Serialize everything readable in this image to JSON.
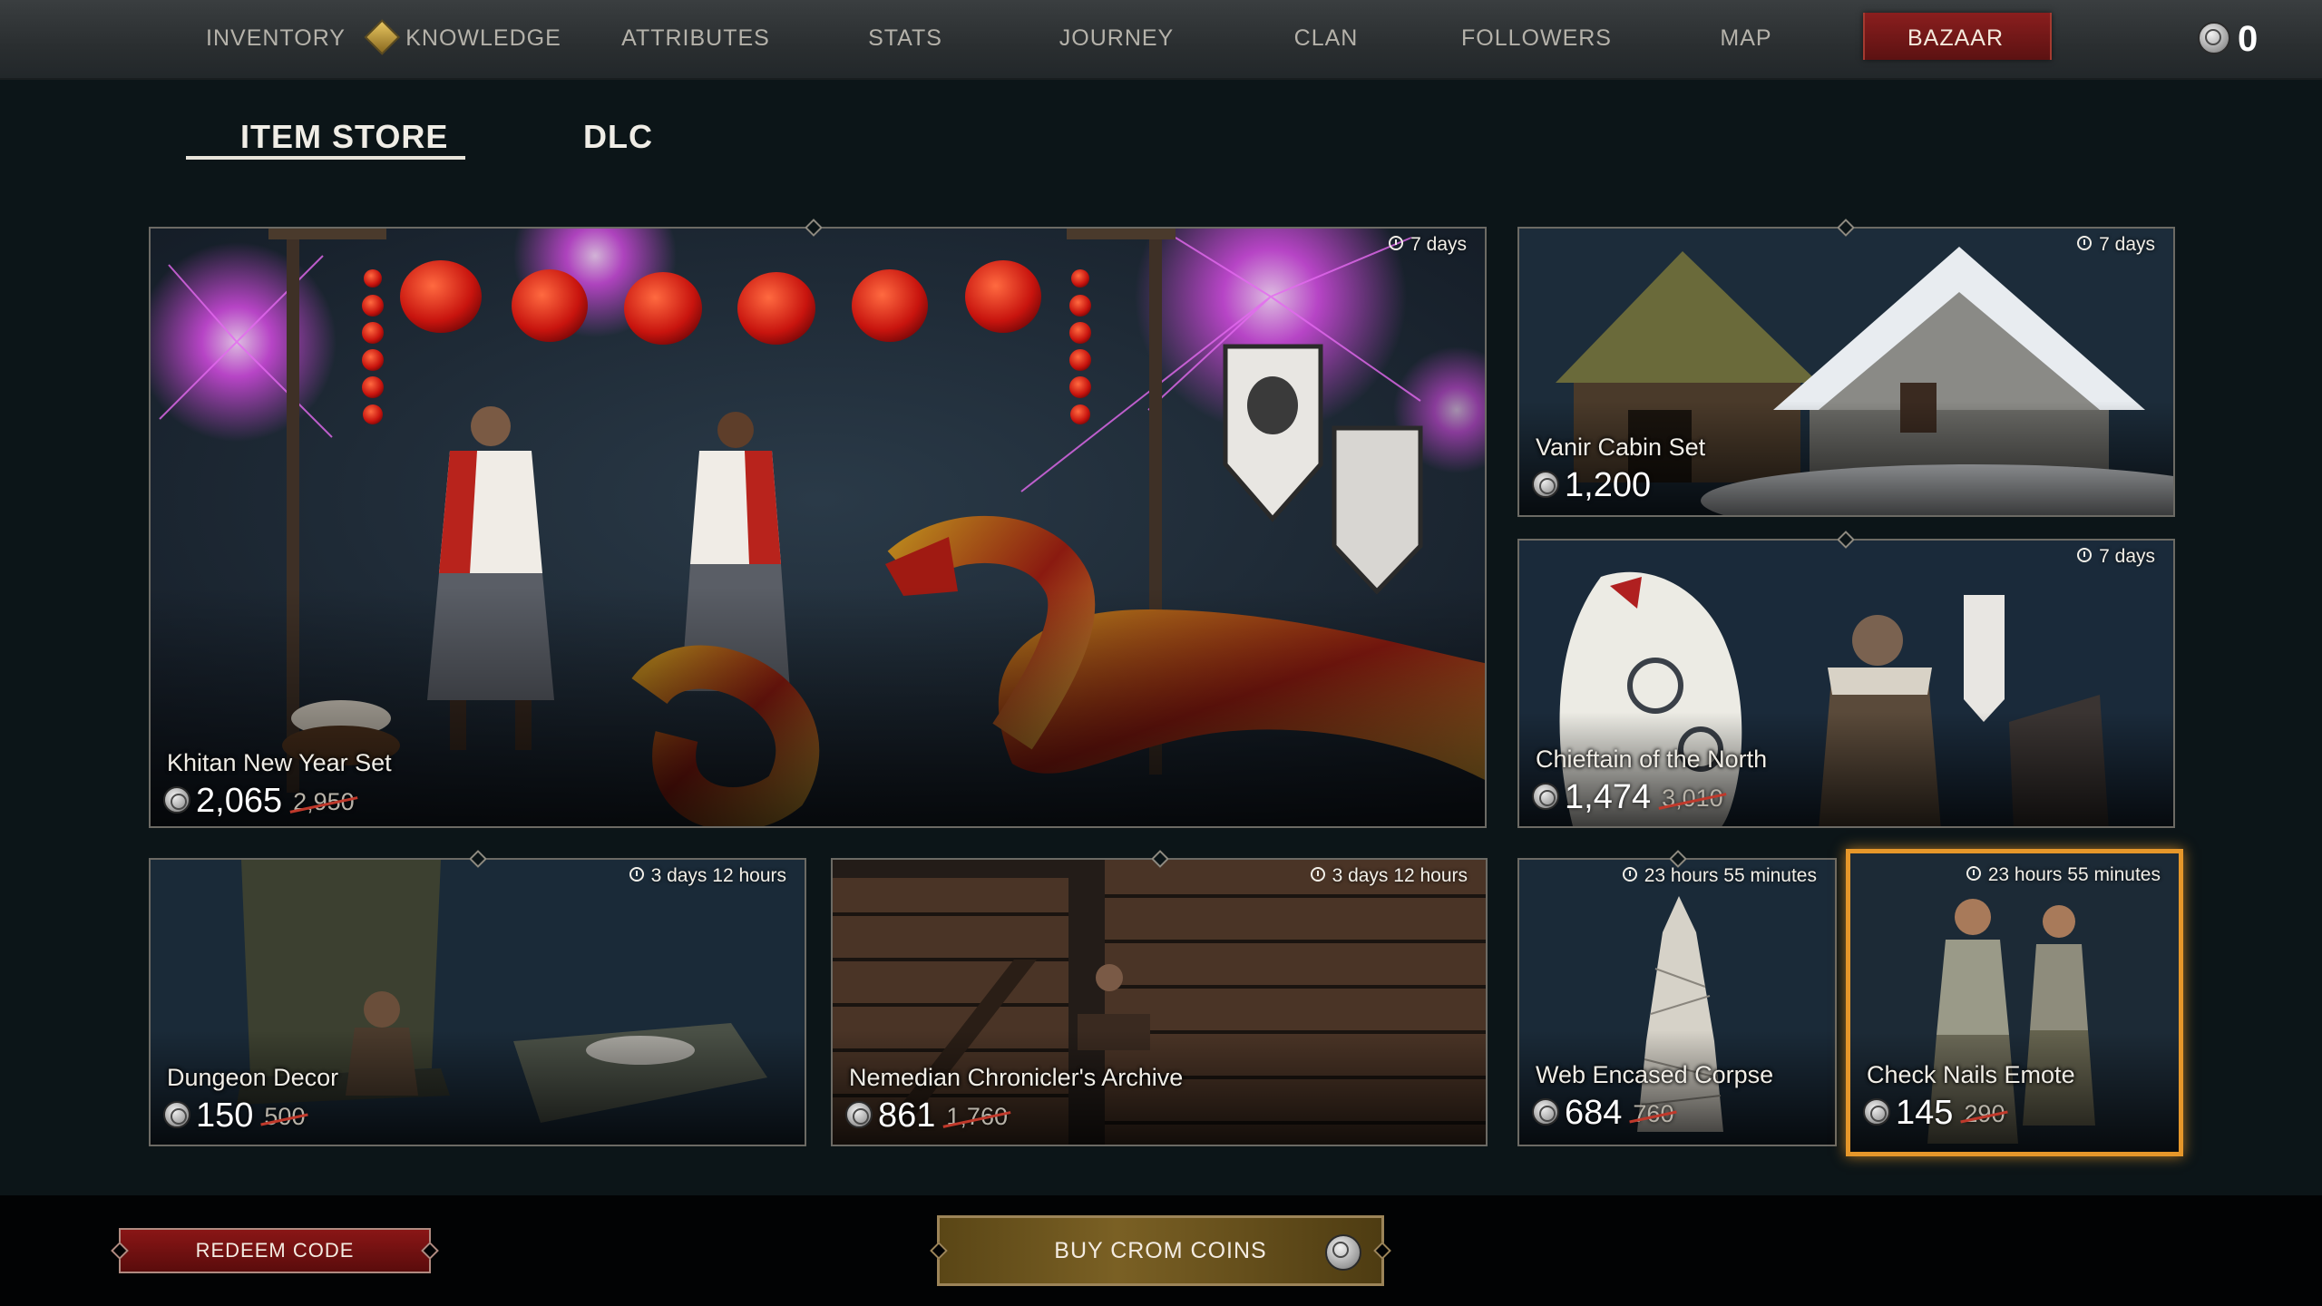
{
  "nav": {
    "items": [
      "Inventory",
      "Knowledge",
      "Attributes",
      "Stats",
      "Journey",
      "Clan",
      "Followers",
      "Map",
      "Bazaar"
    ],
    "active": "Bazaar",
    "balance": "0"
  },
  "tabs": {
    "item_store": "ITEM STORE",
    "dlc": "DLC",
    "active": "ITEM STORE"
  },
  "tiles": {
    "khitan": {
      "name": "Khitan New Year Set",
      "price": "2,065",
      "old_price": "2,950",
      "timer": "7 days"
    },
    "vanir": {
      "name": "Vanir Cabin Set",
      "price": "1,200",
      "timer": "7 days"
    },
    "chieftain": {
      "name": "Chieftain of the North",
      "price": "1,474",
      "old_price": "3,010",
      "timer": "7 days"
    },
    "dungeon": {
      "name": "Dungeon Decor",
      "price": "150",
      "old_price": "500",
      "timer": "3 days 12 hours"
    },
    "nemedian": {
      "name": "Nemedian Chronicler's Archive",
      "price": "861",
      "old_price": "1,760",
      "timer": "3 days 12 hours"
    },
    "web": {
      "name": "Web Encased Corpse",
      "price": "684",
      "old_price": "760",
      "timer": "23 hours 55 minutes"
    },
    "nails": {
      "name": "Check Nails Emote",
      "price": "145",
      "old_price": "290",
      "timer": "23 hours 55 minutes"
    }
  },
  "buttons": {
    "redeem": "REDEEM CODE",
    "buy": "BUY CROM COINS"
  },
  "colors": {
    "active_tab_red": "#7a1818",
    "highlight_orange": "#e6972a",
    "buy_gold": "#7a6024",
    "strike_red": "#c0392b"
  },
  "icons": [
    "knowledge-diamond-icon",
    "crom-coin-icon",
    "timer-icon"
  ]
}
